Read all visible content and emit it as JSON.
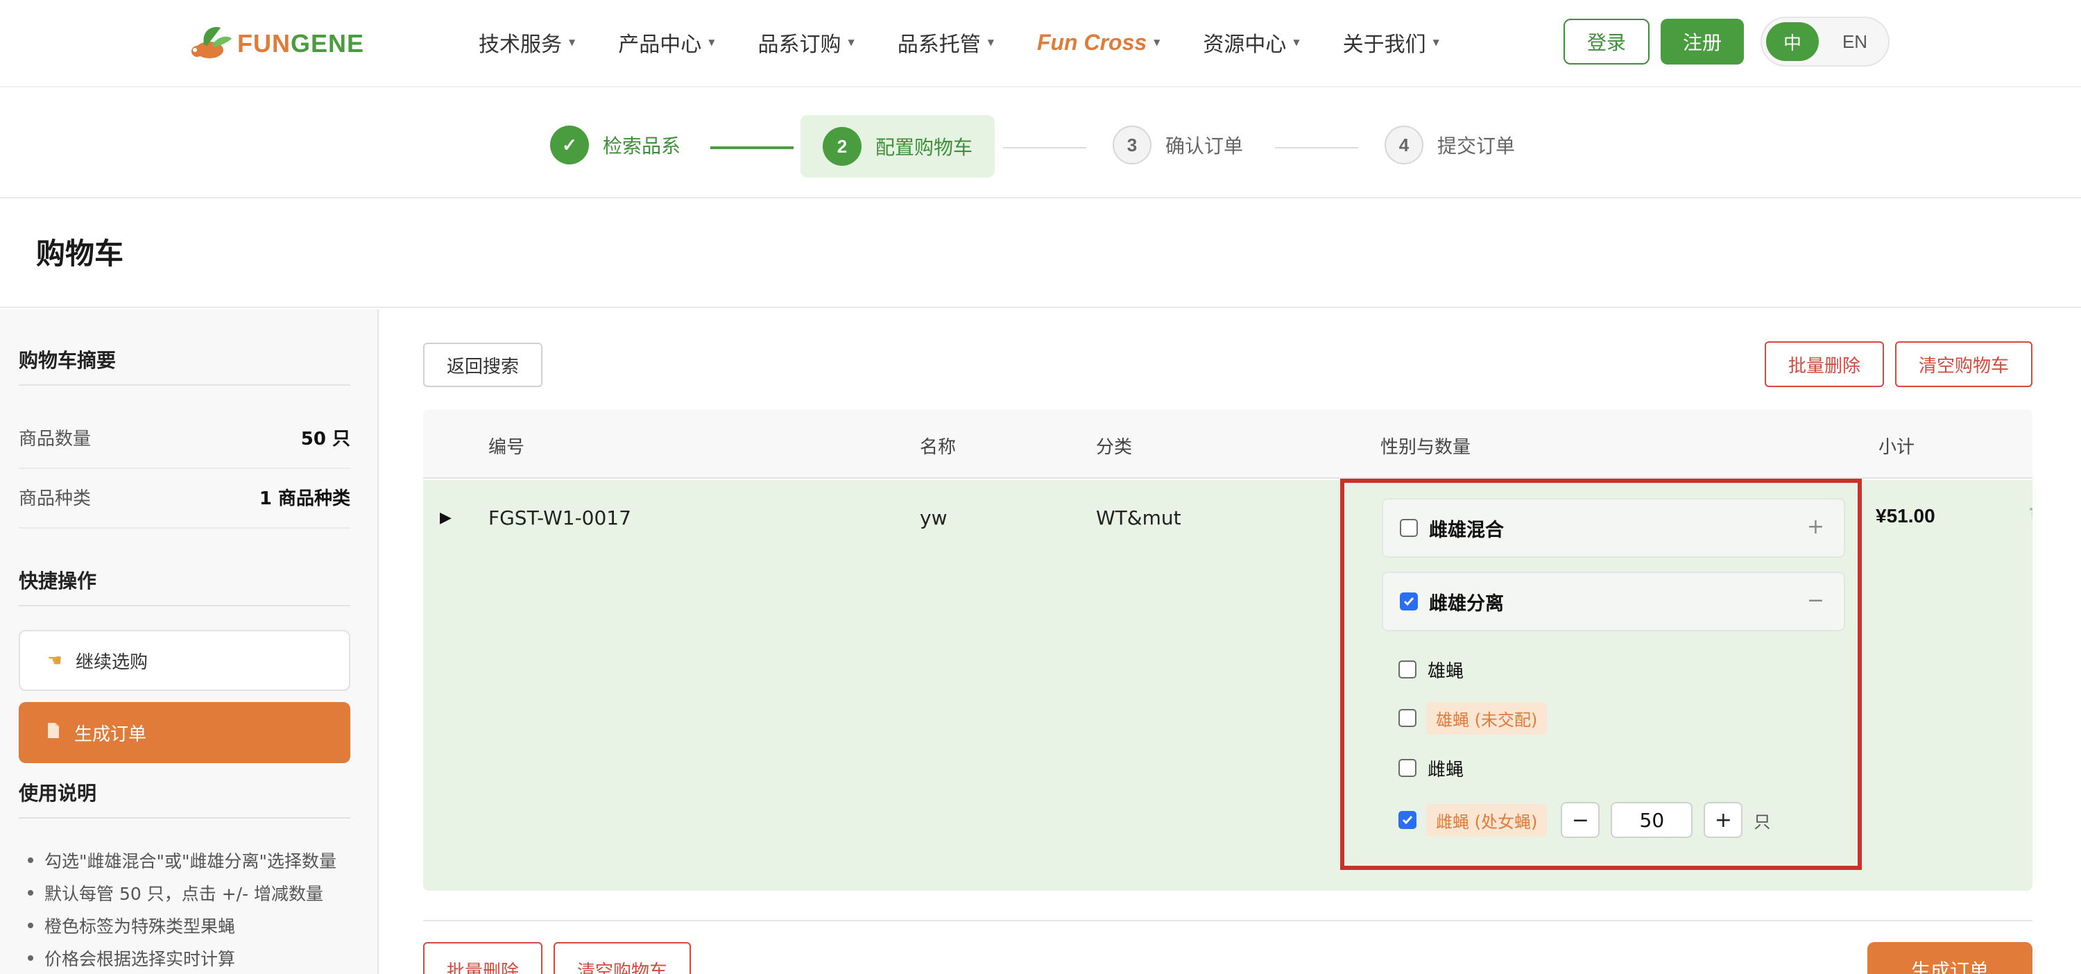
{
  "brand": {
    "fun": "FUN",
    "gene": "GENE"
  },
  "nav": {
    "items": [
      {
        "label": "技术服务"
      },
      {
        "label": "产品中心"
      },
      {
        "label": "品系订购"
      },
      {
        "label": "品系托管"
      },
      {
        "label": "Fun Cross"
      },
      {
        "label": "资源中心"
      },
      {
        "label": "关于我们"
      }
    ],
    "login": "登录",
    "register": "注册",
    "lang": {
      "zh": "中",
      "en": "EN",
      "active": "zh"
    }
  },
  "stepper": {
    "steps": [
      {
        "num": "✓",
        "label": "检索品系",
        "state": "done"
      },
      {
        "num": "2",
        "label": "配置购物车",
        "state": "current"
      },
      {
        "num": "3",
        "label": "确认订单",
        "state": "todo"
      },
      {
        "num": "4",
        "label": "提交订单",
        "state": "todo"
      }
    ]
  },
  "page": {
    "title": "购物车"
  },
  "sidebar": {
    "summary_title": "购物车摘要",
    "rows": [
      {
        "key": "商品数量",
        "value": "50 只"
      },
      {
        "key": "商品种类",
        "value": "1 商品种类"
      }
    ],
    "quick_title": "快捷操作",
    "continue_label": "继续选购",
    "generate_label": "生成订单",
    "usage_title": "使用说明",
    "usage": [
      "勾选\"雌雄混合\"或\"雌雄分离\"选择数量",
      "默认每管 50 只，点击 +/- 增减数量",
      "橙色标签为特殊类型果蝇",
      "价格会根据选择实时计算"
    ]
  },
  "toolbar": {
    "back": "返回搜索",
    "batch_delete": "批量删除",
    "clear_cart": "清空购物车"
  },
  "table": {
    "headers": {
      "id": "编号",
      "name": "名称",
      "category": "分类",
      "sex_qty": "性别与数量",
      "subtotal": "小计"
    },
    "rows": [
      {
        "expand": "▶",
        "id": "FGST-W1-0017",
        "name": "yw",
        "category": "WT&mut",
        "subtotal": "¥51.00",
        "mixed": {
          "label": "雌雄混合",
          "checked": false,
          "sign": "+"
        },
        "separated": {
          "label": "雌雄分离",
          "checked": true,
          "sign": "−"
        },
        "options": [
          {
            "label": "雄蝇",
            "checked": false,
            "tag": false
          },
          {
            "label": "雄蝇 (未交配)",
            "checked": false,
            "tag": true
          },
          {
            "label": "雌蝇",
            "checked": false,
            "tag": false
          },
          {
            "label": "雌蝇 (处女蝇)",
            "checked": true,
            "tag": true,
            "qty": "50",
            "unit": "只"
          }
        ]
      }
    ]
  },
  "footer": {
    "batch_delete": "批量删除",
    "clear_cart": "清空购物车",
    "generate": "生成订单"
  },
  "colors": {
    "brand_green": "#4a9d3f",
    "brand_orange": "#e07b39",
    "danger_red": "#d34a3e",
    "row_highlight": "#e8f3e5",
    "annotation_red": "#c9322a"
  }
}
